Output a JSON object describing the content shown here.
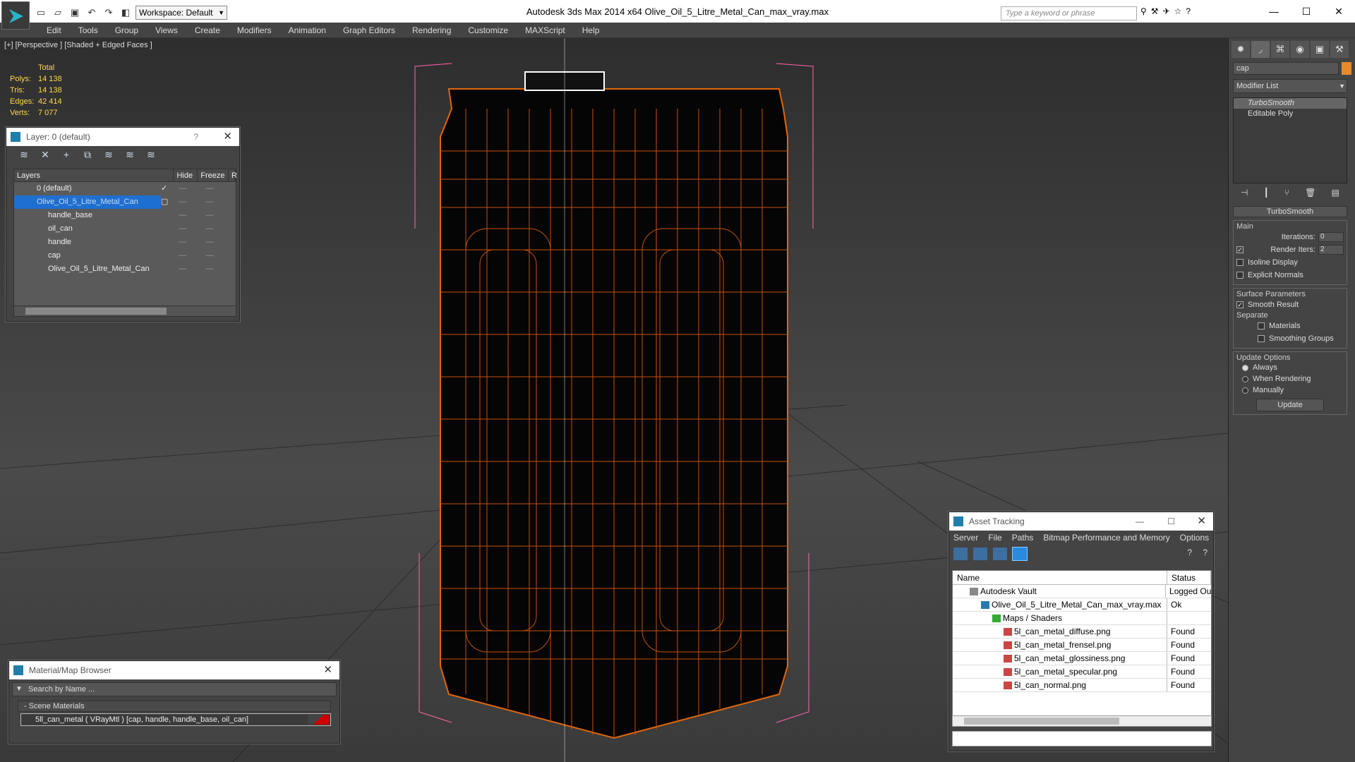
{
  "titlebar": {
    "title": "Autodesk 3ds Max  2014 x64     Olive_Oil_5_Litre_Metal_Can_max_vray.max",
    "workspace": "Workspace: Default",
    "search_placeholder": "Type a keyword or phrase"
  },
  "menu": [
    "Edit",
    "Tools",
    "Group",
    "Views",
    "Create",
    "Modifiers",
    "Animation",
    "Graph Editors",
    "Rendering",
    "Customize",
    "MAXScript",
    "Help"
  ],
  "viewport": {
    "label": "[+] [Perspective ] [Shaded + Edged Faces ]",
    "stats": {
      "header": "Total",
      "rows": [
        {
          "k": "Polys:",
          "v": "14 138"
        },
        {
          "k": "Tris:",
          "v": "14 138"
        },
        {
          "k": "Edges:",
          "v": "42 414"
        },
        {
          "k": "Verts:",
          "v": "7 077"
        }
      ]
    }
  },
  "layer_panel": {
    "title": "Layer: 0 (default)",
    "help": "?",
    "columns": [
      "Layers",
      "Hide",
      "Freeze",
      "R"
    ],
    "rows": [
      {
        "name": "0 (default)",
        "child": false,
        "selected": false
      },
      {
        "name": "Olive_Oil_5_Litre_Metal_Can",
        "child": false,
        "selected": true
      },
      {
        "name": "handle_base",
        "child": true,
        "selected": false
      },
      {
        "name": "oil_can",
        "child": true,
        "selected": false
      },
      {
        "name": "handle",
        "child": true,
        "selected": false
      },
      {
        "name": "cap",
        "child": true,
        "selected": false
      },
      {
        "name": "Olive_Oil_5_Litre_Metal_Can",
        "child": true,
        "selected": false
      }
    ]
  },
  "command_panel": {
    "object_name": "cap",
    "object_color": "#e68a2e",
    "modifier_list": "Modifier List",
    "stack": [
      "TurboSmooth",
      "Editable Poly"
    ],
    "turbosmooth": {
      "title": "TurboSmooth",
      "main_label": "Main",
      "iterations_label": "Iterations:",
      "iterations": "0",
      "render_iters_label": "Render Iters:",
      "render_iters": "2",
      "isoline": "Isoline Display",
      "explicit": "Explicit Normals",
      "surface_label": "Surface Parameters",
      "smooth_result": "Smooth Result",
      "separate_label": "Separate",
      "materials": "Materials",
      "smoothing_groups": "Smoothing Groups",
      "update_label": "Update Options",
      "always": "Always",
      "when_rendering": "When Rendering",
      "manually": "Manually",
      "update_btn": "Update"
    }
  },
  "asset_panel": {
    "title": "Asset Tracking",
    "menu": [
      "Server",
      "File",
      "Paths",
      "Bitmap Performance and Memory",
      "Options"
    ],
    "columns": [
      "Name",
      "Status"
    ],
    "rows": [
      {
        "name": "Autodesk Vault",
        "status": "Logged Ou",
        "indent": 1,
        "icon": "vault"
      },
      {
        "name": "Olive_Oil_5_Litre_Metal_Can_max_vray.max",
        "status": "Ok",
        "indent": 2,
        "icon": "max"
      },
      {
        "name": "Maps / Shaders",
        "status": "",
        "indent": 3,
        "icon": "maps"
      },
      {
        "name": "5l_can_metal_diffuse.png",
        "status": "Found",
        "indent": 4,
        "icon": "png"
      },
      {
        "name": "5l_can_metal_frensel.png",
        "status": "Found",
        "indent": 4,
        "icon": "png"
      },
      {
        "name": "5l_can_metal_glossiness.png",
        "status": "Found",
        "indent": 4,
        "icon": "png"
      },
      {
        "name": "5l_can_metal_specular.png",
        "status": "Found",
        "indent": 4,
        "icon": "png"
      },
      {
        "name": "5l_can_normal.png",
        "status": "Found",
        "indent": 4,
        "icon": "png"
      }
    ]
  },
  "material_panel": {
    "title": "Material/Map Browser",
    "search": "Search by Name ...",
    "group": "- Scene Materials",
    "item": "5ll_can_metal  ( VRayMtl )  [cap, handle, handle_base, oil_can]"
  }
}
